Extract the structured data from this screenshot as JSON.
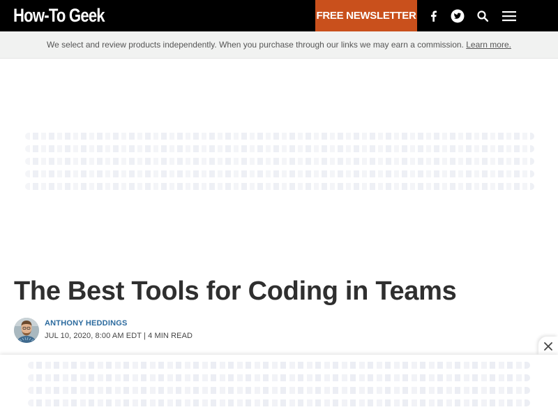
{
  "header": {
    "logo_text": "How-To Geek",
    "newsletter_label": "FREE NEWSLETTER",
    "icons": [
      "facebook-icon",
      "twitter-icon",
      "search-icon",
      "hamburger-menu-icon"
    ],
    "colors": {
      "bar": "#000000",
      "newsletter": "#c9501c"
    }
  },
  "disclosure": {
    "text": "We select and review products independently. When you purchase through our links we may earn a commission.",
    "link_label": "Learn more."
  },
  "article": {
    "title": "The Best Tools for Coding in Teams",
    "author": "ANTHONY HEDDINGS",
    "meta": "JUL 10, 2020, 8:00 AM EDT | 4 MIN READ"
  },
  "ad": {
    "close_icon": "close-icon"
  },
  "colors": {
    "author_link": "#2b6a9e"
  }
}
